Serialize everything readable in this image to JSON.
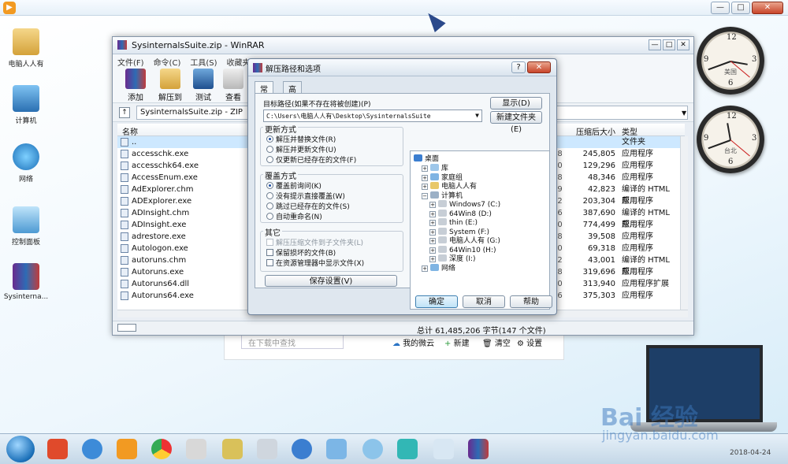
{
  "desktop": {
    "icons": [
      {
        "label": "电脑人人有"
      },
      {
        "label": "计算机"
      },
      {
        "label": "网络"
      },
      {
        "label": "控制面板"
      },
      {
        "label": "Sysinterna..."
      }
    ],
    "clocks": [
      {
        "label": "美国"
      },
      {
        "label": "台北"
      }
    ],
    "download_panel": {
      "search_placeholder": "在下载中查找",
      "links": [
        "我的微云",
        "新建",
        "清空",
        "设置"
      ]
    }
  },
  "winrar": {
    "title": "SysinternalsSuite.zip - WinRAR",
    "menu": [
      "文件(F)",
      "命令(C)",
      "工具(S)",
      "收藏夹(O)"
    ],
    "toolbar": [
      "添加",
      "解压到",
      "测试",
      "查看"
    ],
    "path": "SysinternalsSuite.zip - ZIP",
    "columns": {
      "name": "名称",
      "packed": "压缩后大小",
      "type": "类型"
    },
    "files": [
      {
        "name": "..",
        "size": "",
        "type": "文件夹",
        "cut": ""
      },
      {
        "name": "accesschk.exe",
        "size": "245,805",
        "type": "应用程序",
        "cut": "08"
      },
      {
        "name": "accesschk64.exe",
        "size": "129,296",
        "type": "应用程序",
        "cut": "50"
      },
      {
        "name": "AccessEnum.exe",
        "size": "48,346",
        "type": "应用程序",
        "cut": "68"
      },
      {
        "name": "AdExplorer.chm",
        "size": "42,823",
        "type": "编译的 HTML 帮...",
        "cut": "59"
      },
      {
        "name": "ADExplorer.exe",
        "size": "203,304",
        "type": "应用程序",
        "cut": "72"
      },
      {
        "name": "ADInsight.chm",
        "size": "387,690",
        "type": "编译的 HTML 帮...",
        "cut": "16"
      },
      {
        "name": "ADInsight.exe",
        "size": "774,499",
        "type": "应用程序",
        "cut": "80"
      },
      {
        "name": "adrestore.exe",
        "size": "39,508",
        "type": "应用程序",
        "cut": "28"
      },
      {
        "name": "Autologon.exe",
        "size": "69,318",
        "type": "应用程序",
        "cut": "20"
      },
      {
        "name": "autoruns.chm",
        "size": "43,001",
        "type": "编译的 HTML 帮...",
        "cut": "12"
      },
      {
        "name": "Autoruns.exe",
        "size": "319,696",
        "type": "应用程序",
        "cut": "08"
      },
      {
        "name": "Autoruns64.dll",
        "size": "313,940",
        "type": "应用程序扩展",
        "cut": "40"
      },
      {
        "name": "Autoruns64.exe",
        "size": "375,303",
        "type": "应用程序",
        "cut": "56"
      }
    ],
    "status": "总计 61,485,206 字节(147 个文件)"
  },
  "dialog": {
    "title": "解压路径和选项",
    "tabs": [
      "常规",
      "高级"
    ],
    "target_label": "目标路径(如果不存在将被创建)(P)",
    "target_value": "C:\\Users\\电脑人人有\\Desktop\\SysinternalsSuite",
    "show_button": "显示(D)",
    "newfolder_button": "新建文件夹(E)",
    "update_group": {
      "label": "更新方式",
      "options": [
        "解压并替换文件(R)",
        "解压并更新文件(U)",
        "仅更新已经存在的文件(F)"
      ]
    },
    "overwrite_group": {
      "label": "覆盖方式",
      "options": [
        "覆盖前询问(K)",
        "没有提示直接覆盖(W)",
        "跳过已经存在的文件(S)",
        "自动重命名(N)"
      ]
    },
    "misc_group": {
      "label": "其它",
      "options": [
        "解压压缩文件到子文件夹(L)",
        "保留损坏的文件(B)",
        "在资源管理器中显示文件(X)"
      ]
    },
    "save_button": "保存设置(V)",
    "tree": {
      "desktop": "桌面",
      "items": [
        "库",
        "家庭组",
        "电脑人人有",
        "计算机",
        "Windows7 (C:)",
        "64Win8 (D:)",
        "thin (E:)",
        "System (F:)",
        "电脑人人有 (G:)",
        "64Win10 (H:)",
        "深度 (I:)",
        "网络"
      ]
    },
    "ok": "确定",
    "cancel": "取消",
    "help": "帮助"
  },
  "taskbar": {
    "date": "2018-04-24"
  },
  "watermark": {
    "brand": "Bai 经验",
    "url": "jingyan.baidu.com"
  },
  "colors": {
    "accent": "#1d4fa3",
    "selection": "#cde8ff"
  }
}
